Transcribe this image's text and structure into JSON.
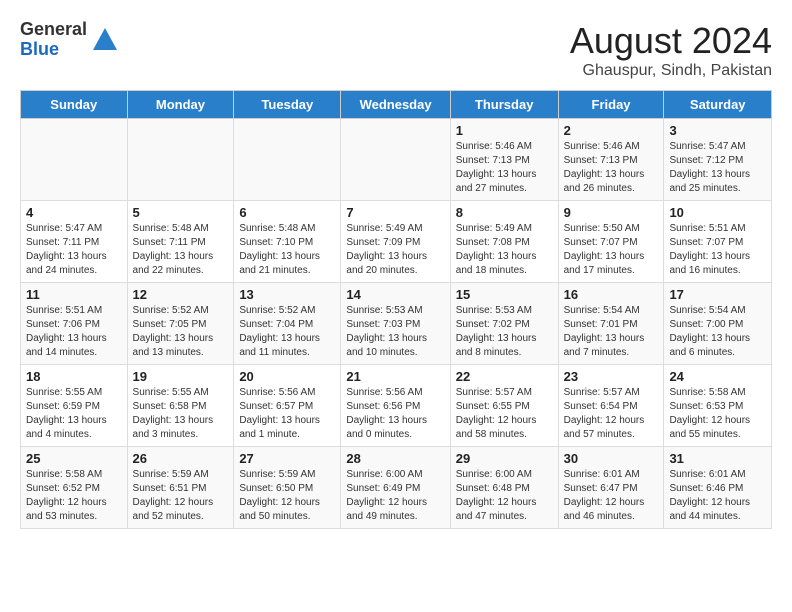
{
  "header": {
    "logo_general": "General",
    "logo_blue": "Blue",
    "month_year": "August 2024",
    "location": "Ghauspur, Sindh, Pakistan"
  },
  "weekdays": [
    "Sunday",
    "Monday",
    "Tuesday",
    "Wednesday",
    "Thursday",
    "Friday",
    "Saturday"
  ],
  "weeks": [
    [
      {
        "day": "",
        "info": ""
      },
      {
        "day": "",
        "info": ""
      },
      {
        "day": "",
        "info": ""
      },
      {
        "day": "",
        "info": ""
      },
      {
        "day": "1",
        "info": "Sunrise: 5:46 AM\nSunset: 7:13 PM\nDaylight: 13 hours\nand 27 minutes."
      },
      {
        "day": "2",
        "info": "Sunrise: 5:46 AM\nSunset: 7:13 PM\nDaylight: 13 hours\nand 26 minutes."
      },
      {
        "day": "3",
        "info": "Sunrise: 5:47 AM\nSunset: 7:12 PM\nDaylight: 13 hours\nand 25 minutes."
      }
    ],
    [
      {
        "day": "4",
        "info": "Sunrise: 5:47 AM\nSunset: 7:11 PM\nDaylight: 13 hours\nand 24 minutes."
      },
      {
        "day": "5",
        "info": "Sunrise: 5:48 AM\nSunset: 7:11 PM\nDaylight: 13 hours\nand 22 minutes."
      },
      {
        "day": "6",
        "info": "Sunrise: 5:48 AM\nSunset: 7:10 PM\nDaylight: 13 hours\nand 21 minutes."
      },
      {
        "day": "7",
        "info": "Sunrise: 5:49 AM\nSunset: 7:09 PM\nDaylight: 13 hours\nand 20 minutes."
      },
      {
        "day": "8",
        "info": "Sunrise: 5:49 AM\nSunset: 7:08 PM\nDaylight: 13 hours\nand 18 minutes."
      },
      {
        "day": "9",
        "info": "Sunrise: 5:50 AM\nSunset: 7:07 PM\nDaylight: 13 hours\nand 17 minutes."
      },
      {
        "day": "10",
        "info": "Sunrise: 5:51 AM\nSunset: 7:07 PM\nDaylight: 13 hours\nand 16 minutes."
      }
    ],
    [
      {
        "day": "11",
        "info": "Sunrise: 5:51 AM\nSunset: 7:06 PM\nDaylight: 13 hours\nand 14 minutes."
      },
      {
        "day": "12",
        "info": "Sunrise: 5:52 AM\nSunset: 7:05 PM\nDaylight: 13 hours\nand 13 minutes."
      },
      {
        "day": "13",
        "info": "Sunrise: 5:52 AM\nSunset: 7:04 PM\nDaylight: 13 hours\nand 11 minutes."
      },
      {
        "day": "14",
        "info": "Sunrise: 5:53 AM\nSunset: 7:03 PM\nDaylight: 13 hours\nand 10 minutes."
      },
      {
        "day": "15",
        "info": "Sunrise: 5:53 AM\nSunset: 7:02 PM\nDaylight: 13 hours\nand 8 minutes."
      },
      {
        "day": "16",
        "info": "Sunrise: 5:54 AM\nSunset: 7:01 PM\nDaylight: 13 hours\nand 7 minutes."
      },
      {
        "day": "17",
        "info": "Sunrise: 5:54 AM\nSunset: 7:00 PM\nDaylight: 13 hours\nand 6 minutes."
      }
    ],
    [
      {
        "day": "18",
        "info": "Sunrise: 5:55 AM\nSunset: 6:59 PM\nDaylight: 13 hours\nand 4 minutes."
      },
      {
        "day": "19",
        "info": "Sunrise: 5:55 AM\nSunset: 6:58 PM\nDaylight: 13 hours\nand 3 minutes."
      },
      {
        "day": "20",
        "info": "Sunrise: 5:56 AM\nSunset: 6:57 PM\nDaylight: 13 hours\nand 1 minute."
      },
      {
        "day": "21",
        "info": "Sunrise: 5:56 AM\nSunset: 6:56 PM\nDaylight: 13 hours\nand 0 minutes."
      },
      {
        "day": "22",
        "info": "Sunrise: 5:57 AM\nSunset: 6:55 PM\nDaylight: 12 hours\nand 58 minutes."
      },
      {
        "day": "23",
        "info": "Sunrise: 5:57 AM\nSunset: 6:54 PM\nDaylight: 12 hours\nand 57 minutes."
      },
      {
        "day": "24",
        "info": "Sunrise: 5:58 AM\nSunset: 6:53 PM\nDaylight: 12 hours\nand 55 minutes."
      }
    ],
    [
      {
        "day": "25",
        "info": "Sunrise: 5:58 AM\nSunset: 6:52 PM\nDaylight: 12 hours\nand 53 minutes."
      },
      {
        "day": "26",
        "info": "Sunrise: 5:59 AM\nSunset: 6:51 PM\nDaylight: 12 hours\nand 52 minutes."
      },
      {
        "day": "27",
        "info": "Sunrise: 5:59 AM\nSunset: 6:50 PM\nDaylight: 12 hours\nand 50 minutes."
      },
      {
        "day": "28",
        "info": "Sunrise: 6:00 AM\nSunset: 6:49 PM\nDaylight: 12 hours\nand 49 minutes."
      },
      {
        "day": "29",
        "info": "Sunrise: 6:00 AM\nSunset: 6:48 PM\nDaylight: 12 hours\nand 47 minutes."
      },
      {
        "day": "30",
        "info": "Sunrise: 6:01 AM\nSunset: 6:47 PM\nDaylight: 12 hours\nand 46 minutes."
      },
      {
        "day": "31",
        "info": "Sunrise: 6:01 AM\nSunset: 6:46 PM\nDaylight: 12 hours\nand 44 minutes."
      }
    ]
  ]
}
